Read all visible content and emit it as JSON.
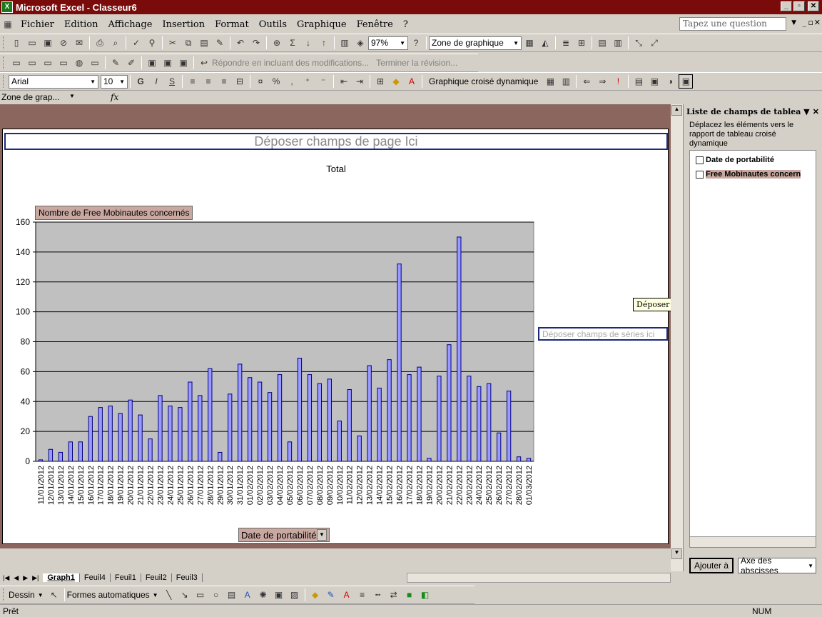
{
  "window": {
    "title": "Microsoft Excel - Classeur6"
  },
  "menu": {
    "items": [
      "Fichier",
      "Edition",
      "Affichage",
      "Insertion",
      "Format",
      "Outils",
      "Graphique",
      "Fenêtre",
      "?"
    ]
  },
  "help": {
    "placeholder": "Tapez une question"
  },
  "toolbar1": {
    "zoom": "97%",
    "chart_object": "Zone de graphique"
  },
  "toolbar2": {
    "reply_label": "Répondre en incluant des modifications...",
    "end_review": "Terminer la révision..."
  },
  "toolbar3": {
    "font": "Arial",
    "size": "10",
    "bold": "G",
    "italic": "I",
    "underline": "S",
    "pivotchart": "Graphique croisé dynamique"
  },
  "formula": {
    "namebox": "Zone de grap...",
    "fx": "fx"
  },
  "chart": {
    "page_field_drop": "Déposer champs de page Ici",
    "series_drop": "Déposer champs de séries ici",
    "tooltip": "Déposer champs de séries ici",
    "data_field": "Nombre de Free Mobinautes concernés",
    "category_field": "Date de portabilité"
  },
  "chart_data": {
    "type": "bar",
    "title": "",
    "legend": "Total",
    "xlabel": "Date de portabilité",
    "ylabel": "Nombre de Free Mobinautes concernés",
    "ylim": [
      0,
      160
    ],
    "yticks": [
      0,
      20,
      40,
      60,
      80,
      100,
      120,
      140,
      160
    ],
    "grid": true,
    "series": [
      {
        "name": "Total",
        "color": "#9999ff"
      }
    ],
    "categories": [
      "11/01/2012",
      "12/01/2012",
      "13/01/2012",
      "14/01/2012",
      "15/01/2012",
      "16/01/2012",
      "17/01/2012",
      "18/01/2012",
      "19/01/2012",
      "20/01/2012",
      "21/01/2012",
      "22/01/2012",
      "23/01/2012",
      "24/01/2012",
      "25/01/2012",
      "26/01/2012",
      "27/01/2012",
      "28/01/2012",
      "29/01/2012",
      "30/01/2012",
      "31/01/2012",
      "01/02/2012",
      "02/02/2012",
      "03/02/2012",
      "04/02/2012",
      "05/02/2012",
      "06/02/2012",
      "07/02/2012",
      "08/02/2012",
      "09/02/2012",
      "10/02/2012",
      "11/02/2012",
      "12/02/2012",
      "13/02/2012",
      "14/02/2012",
      "15/02/2012",
      "16/02/2012",
      "17/02/2012",
      "18/02/2012",
      "19/02/2012",
      "20/02/2012",
      "21/02/2012",
      "22/02/2012",
      "23/02/2012",
      "24/02/2012",
      "25/02/2012",
      "26/02/2012",
      "27/02/2012",
      "28/02/2012",
      "01/03/2012"
    ],
    "values": [
      1,
      8,
      6,
      13,
      13,
      30,
      36,
      37,
      32,
      41,
      31,
      15,
      44,
      37,
      36,
      53,
      44,
      62,
      6,
      45,
      65,
      56,
      53,
      46,
      58,
      13,
      69,
      58,
      52,
      55,
      27,
      48,
      17,
      64,
      49,
      68,
      132,
      58,
      63,
      2,
      57,
      78,
      150,
      57,
      50,
      52,
      19,
      47,
      3,
      2
    ]
  },
  "sheets": {
    "tabs": [
      "Graph1",
      "Feuil4",
      "Feuil1",
      "Feuil2",
      "Feuil3"
    ],
    "active": "Graph1"
  },
  "drawing": {
    "dessin": "Dessin",
    "formes": "Formes automatiques"
  },
  "status": {
    "left": "Prêt",
    "num": "NUM"
  },
  "panel": {
    "title": "Liste de champs de tableau c",
    "description": "Déplacez les éléments vers le rapport de tableau croisé dynamique",
    "fields": [
      "Date de portabilité",
      "Free Mobinautes concern"
    ],
    "add_button": "Ajouter à",
    "axis_select": "Axe des abscisses"
  }
}
